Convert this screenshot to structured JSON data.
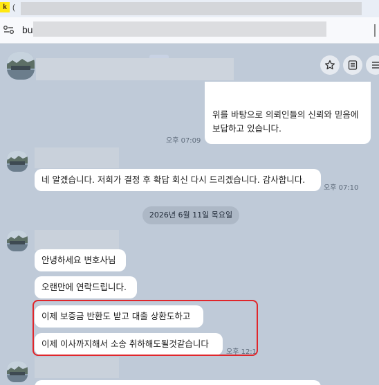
{
  "browser": {
    "tab_icon_letter": "k",
    "tab_title_prefix": "(",
    "url_prefix": "bu"
  },
  "chat": {
    "header": {
      "icons": [
        "star-icon",
        "notes-icon",
        "menu-icon"
      ]
    },
    "messages": {
      "m1_line1": "위를 바탕으로 의뢰인들의 신뢰와 믿음에",
      "m1_line2": "보답하고 있습니다.",
      "m1_time": "오후 07:09",
      "m2_text": "네 알겠습니다. 저희가 결정 후 확답 회신 다시 드리겠습니다. 감사합니다.",
      "m2_time": "오후 07:10",
      "date_separator": "2026년 6월 11일 목요일",
      "m3_text": "안녕하세요 변호사님",
      "m4_text": "오랜만에 연락드립니다.",
      "m5_text": "이제 보증금 반환도 받고 대출 상환도하고",
      "m6_text": "이제 이사까지해서 소송 취하해도될것같습니다",
      "m6_time": "오후 12:1"
    },
    "colors": {
      "background": "#bfcad8",
      "bubble": "#ffffff",
      "highlight": "#e0262b"
    }
  }
}
